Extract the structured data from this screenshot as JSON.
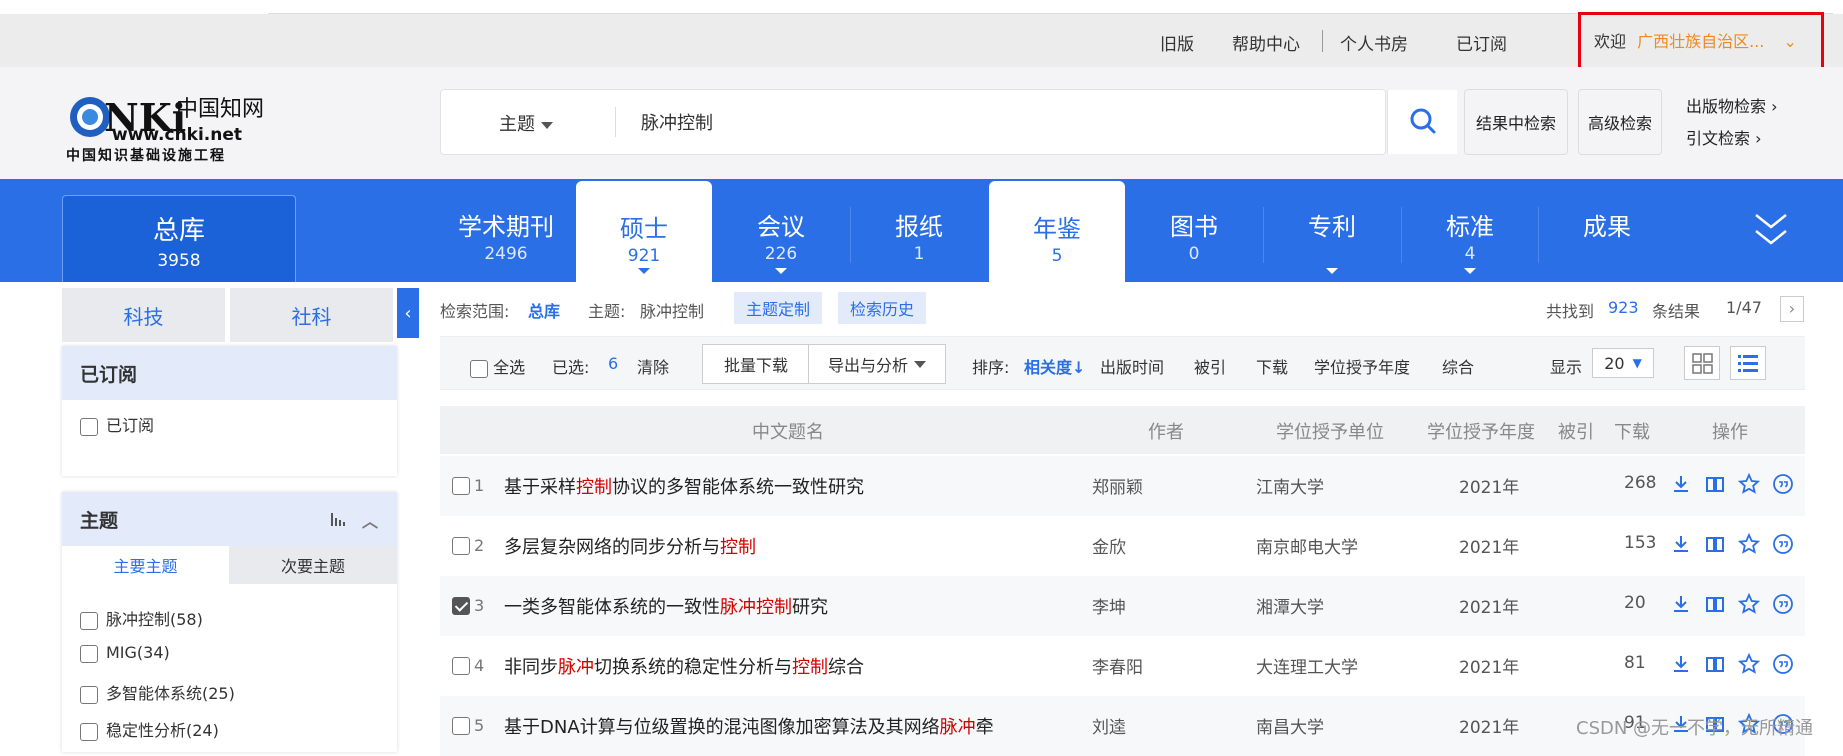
{
  "topbar": {
    "links": [
      "旧版",
      "帮助中心",
      "个人书房",
      "已订阅"
    ],
    "welcome_label": "欢迎",
    "org": "广西壮族自治区..."
  },
  "logo": {
    "name_cn": "中国知网",
    "url_text": "www.cnki.net",
    "slogan": "中国知识基础设施工程"
  },
  "search": {
    "scope": "主题",
    "query": "脉冲控制",
    "in_result_label": "结果中检索",
    "advanced_label": "高级检索",
    "publication_search": "出版物检索",
    "citation_search": "引文检索"
  },
  "nav": {
    "zongku": {
      "label": "总库",
      "count": "3958"
    },
    "tabs": [
      {
        "label": "学术期刊",
        "count": "2496"
      },
      {
        "label": "硕士",
        "count": "921"
      },
      {
        "label": "会议",
        "count": "226"
      },
      {
        "label": "报纸",
        "count": "1"
      },
      {
        "label": "年鉴",
        "count": "5"
      },
      {
        "label": "图书",
        "count": "0"
      },
      {
        "label": "专利",
        "count": ""
      },
      {
        "label": "标准",
        "count": "4"
      },
      {
        "label": "成果",
        "count": ""
      }
    ]
  },
  "sidebar": {
    "tabs": [
      "科技",
      "社科"
    ],
    "subscribed": {
      "title": "已订阅",
      "item": "已订阅"
    },
    "topic": {
      "title": "主题",
      "subtabs": [
        "主要主题",
        "次要主题"
      ],
      "items": [
        "脉冲控制(58)",
        "MIG(34)",
        "多智能体系统(25)",
        "稳定性分析(24)"
      ]
    }
  },
  "range": {
    "scope_label": "检索范围:",
    "scope_value": "总库",
    "topic_label": "主题:",
    "topic_value": "脉冲控制",
    "custom_btn": "主题定制",
    "history_btn": "检索历史",
    "found_prefix": "共找到",
    "found_count": "923",
    "found_suffix": "条结果",
    "page": "1/47"
  },
  "toolbar": {
    "select_all": "全选",
    "selected_label": "已选:",
    "selected_count": "6",
    "clear": "清除",
    "batch_download": "批量下载",
    "export": "导出与分析",
    "sort_label": "排序:",
    "sort_options": [
      "相关度",
      "出版时间",
      "被引",
      "下载",
      "学位授予年度",
      "综合"
    ],
    "display_label": "显示",
    "display_value": "20"
  },
  "table": {
    "headers": [
      "中文题名",
      "作者",
      "学位授予单位",
      "学位授予年度",
      "被引",
      "下载",
      "操作"
    ],
    "rows": [
      {
        "num": "1",
        "title": [
          "基于采样",
          "控制",
          "协议的多智能体系统一致性研究"
        ],
        "author": "郑丽颖",
        "unit": "江南大学",
        "year": "2021年",
        "cited": "",
        "downloads": "268",
        "checked": false
      },
      {
        "num": "2",
        "title": [
          "多层复杂网络的同步分析与",
          "控制",
          ""
        ],
        "author": "金欣",
        "unit": "南京邮电大学",
        "year": "2021年",
        "cited": "",
        "downloads": "153",
        "checked": false
      },
      {
        "num": "3",
        "title": [
          "一类多智能体系统的一致性",
          "脉冲控制",
          "研究"
        ],
        "author": "李坤",
        "unit": "湘潭大学",
        "year": "2021年",
        "cited": "",
        "downloads": "20",
        "checked": true
      },
      {
        "num": "4",
        "title": [
          "非同步",
          "脉冲",
          "切换系统的稳定性分析与",
          "控制",
          "综合"
        ],
        "author": "李春阳",
        "unit": "大连理工大学",
        "year": "2021年",
        "cited": "",
        "downloads": "81",
        "checked": false
      },
      {
        "num": "5",
        "title": [
          "基于DNA计算与位级置换的混沌图像加密算法及其网络",
          "脉冲",
          "牵"
        ],
        "author": "刘逵",
        "unit": "南昌大学",
        "year": "2021年",
        "cited": "",
        "downloads": "91",
        "checked": false
      }
    ]
  },
  "watermark": "CSDN @无一不学，无所精通",
  "colors": {
    "brand_blue": "#2a6fe6",
    "highlight_red": "#d40000",
    "orange": "#f08a1c",
    "red_box": "#e60012"
  }
}
